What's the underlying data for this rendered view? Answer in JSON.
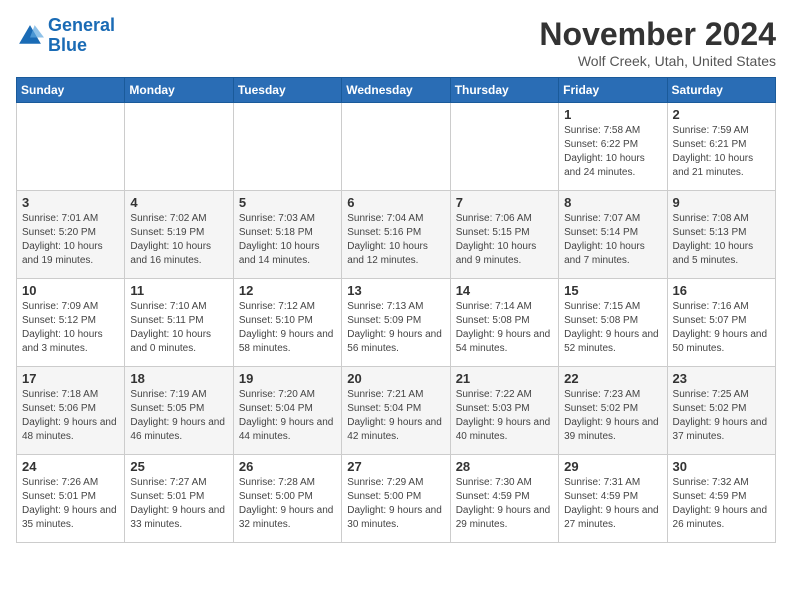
{
  "logo": {
    "line1": "General",
    "line2": "Blue"
  },
  "title": "November 2024",
  "location": "Wolf Creek, Utah, United States",
  "weekdays": [
    "Sunday",
    "Monday",
    "Tuesday",
    "Wednesday",
    "Thursday",
    "Friday",
    "Saturday"
  ],
  "weeks": [
    [
      {
        "day": "",
        "info": ""
      },
      {
        "day": "",
        "info": ""
      },
      {
        "day": "",
        "info": ""
      },
      {
        "day": "",
        "info": ""
      },
      {
        "day": "",
        "info": ""
      },
      {
        "day": "1",
        "info": "Sunrise: 7:58 AM\nSunset: 6:22 PM\nDaylight: 10 hours and 24 minutes."
      },
      {
        "day": "2",
        "info": "Sunrise: 7:59 AM\nSunset: 6:21 PM\nDaylight: 10 hours and 21 minutes."
      }
    ],
    [
      {
        "day": "3",
        "info": "Sunrise: 7:01 AM\nSunset: 5:20 PM\nDaylight: 10 hours and 19 minutes."
      },
      {
        "day": "4",
        "info": "Sunrise: 7:02 AM\nSunset: 5:19 PM\nDaylight: 10 hours and 16 minutes."
      },
      {
        "day": "5",
        "info": "Sunrise: 7:03 AM\nSunset: 5:18 PM\nDaylight: 10 hours and 14 minutes."
      },
      {
        "day": "6",
        "info": "Sunrise: 7:04 AM\nSunset: 5:16 PM\nDaylight: 10 hours and 12 minutes."
      },
      {
        "day": "7",
        "info": "Sunrise: 7:06 AM\nSunset: 5:15 PM\nDaylight: 10 hours and 9 minutes."
      },
      {
        "day": "8",
        "info": "Sunrise: 7:07 AM\nSunset: 5:14 PM\nDaylight: 10 hours and 7 minutes."
      },
      {
        "day": "9",
        "info": "Sunrise: 7:08 AM\nSunset: 5:13 PM\nDaylight: 10 hours and 5 minutes."
      }
    ],
    [
      {
        "day": "10",
        "info": "Sunrise: 7:09 AM\nSunset: 5:12 PM\nDaylight: 10 hours and 3 minutes."
      },
      {
        "day": "11",
        "info": "Sunrise: 7:10 AM\nSunset: 5:11 PM\nDaylight: 10 hours and 0 minutes."
      },
      {
        "day": "12",
        "info": "Sunrise: 7:12 AM\nSunset: 5:10 PM\nDaylight: 9 hours and 58 minutes."
      },
      {
        "day": "13",
        "info": "Sunrise: 7:13 AM\nSunset: 5:09 PM\nDaylight: 9 hours and 56 minutes."
      },
      {
        "day": "14",
        "info": "Sunrise: 7:14 AM\nSunset: 5:08 PM\nDaylight: 9 hours and 54 minutes."
      },
      {
        "day": "15",
        "info": "Sunrise: 7:15 AM\nSunset: 5:08 PM\nDaylight: 9 hours and 52 minutes."
      },
      {
        "day": "16",
        "info": "Sunrise: 7:16 AM\nSunset: 5:07 PM\nDaylight: 9 hours and 50 minutes."
      }
    ],
    [
      {
        "day": "17",
        "info": "Sunrise: 7:18 AM\nSunset: 5:06 PM\nDaylight: 9 hours and 48 minutes."
      },
      {
        "day": "18",
        "info": "Sunrise: 7:19 AM\nSunset: 5:05 PM\nDaylight: 9 hours and 46 minutes."
      },
      {
        "day": "19",
        "info": "Sunrise: 7:20 AM\nSunset: 5:04 PM\nDaylight: 9 hours and 44 minutes."
      },
      {
        "day": "20",
        "info": "Sunrise: 7:21 AM\nSunset: 5:04 PM\nDaylight: 9 hours and 42 minutes."
      },
      {
        "day": "21",
        "info": "Sunrise: 7:22 AM\nSunset: 5:03 PM\nDaylight: 9 hours and 40 minutes."
      },
      {
        "day": "22",
        "info": "Sunrise: 7:23 AM\nSunset: 5:02 PM\nDaylight: 9 hours and 39 minutes."
      },
      {
        "day": "23",
        "info": "Sunrise: 7:25 AM\nSunset: 5:02 PM\nDaylight: 9 hours and 37 minutes."
      }
    ],
    [
      {
        "day": "24",
        "info": "Sunrise: 7:26 AM\nSunset: 5:01 PM\nDaylight: 9 hours and 35 minutes."
      },
      {
        "day": "25",
        "info": "Sunrise: 7:27 AM\nSunset: 5:01 PM\nDaylight: 9 hours and 33 minutes."
      },
      {
        "day": "26",
        "info": "Sunrise: 7:28 AM\nSunset: 5:00 PM\nDaylight: 9 hours and 32 minutes."
      },
      {
        "day": "27",
        "info": "Sunrise: 7:29 AM\nSunset: 5:00 PM\nDaylight: 9 hours and 30 minutes."
      },
      {
        "day": "28",
        "info": "Sunrise: 7:30 AM\nSunset: 4:59 PM\nDaylight: 9 hours and 29 minutes."
      },
      {
        "day": "29",
        "info": "Sunrise: 7:31 AM\nSunset: 4:59 PM\nDaylight: 9 hours and 27 minutes."
      },
      {
        "day": "30",
        "info": "Sunrise: 7:32 AM\nSunset: 4:59 PM\nDaylight: 9 hours and 26 minutes."
      }
    ]
  ]
}
